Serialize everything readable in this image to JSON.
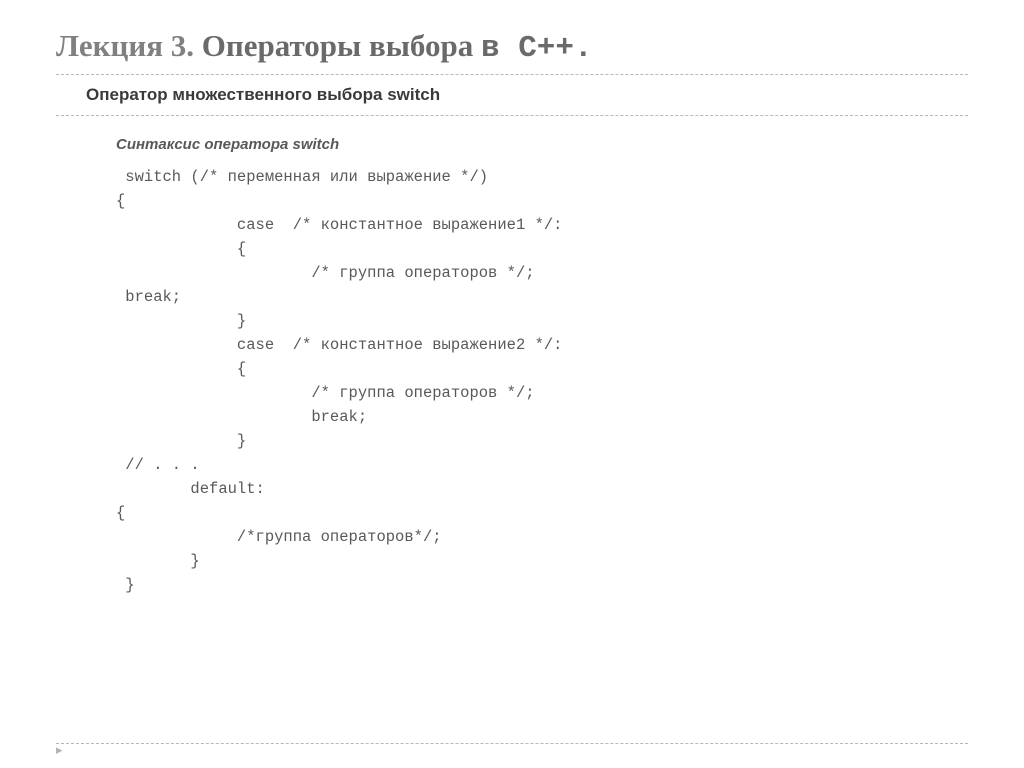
{
  "title": {
    "part1": "Лекция 3. ",
    "part2_bold": "Операторы выбора ",
    "part3_mono": "в С++."
  },
  "subtitle": "Оператор множественного выбора switch",
  "syntax_label": "Синтаксис оператора switch",
  "code": " switch (/* переменная или выражение */)\n{\n             case  /* константное выражение1 */:\n             {\n                     /* группа операторов */;\n break;\n             }\n             case  /* константное выражение2 */:\n             {\n                     /* группа операторов */;\n                     break;\n             }\n // . . .\n        default:\n{\n             /*группа операторов*/;\n        }\n }",
  "footer_marker": "▸"
}
